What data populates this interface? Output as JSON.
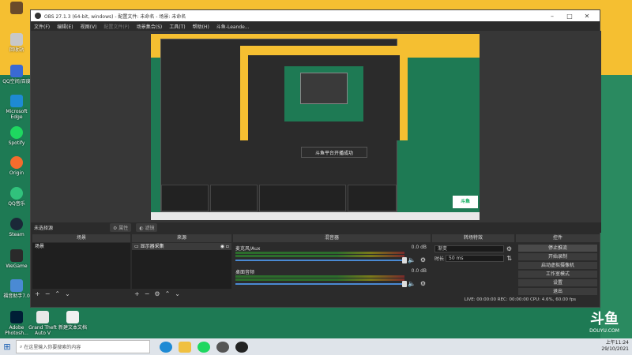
{
  "desktop": {
    "icons": [
      {
        "label": "",
        "color": "#6a4a2a"
      },
      {
        "label": "回收站",
        "color": "#c8c8c8"
      },
      {
        "label": "QQ空间/百度",
        "color": "#3a6ad4"
      },
      {
        "label": "Microsoft Edge",
        "color": "#1e8ad4"
      },
      {
        "label": "Spotify",
        "color": "#1ed760"
      },
      {
        "label": "Origin",
        "color": "#f56c2d"
      },
      {
        "label": "QQ音乐",
        "color": "#31c27c"
      },
      {
        "label": "Steam",
        "color": "#1b2838"
      },
      {
        "label": "WeGame",
        "color": "#2a2a2a"
      },
      {
        "label": "福音助手7.0",
        "color": "#4a8ad4"
      },
      {
        "label": "Adobe Photosh...",
        "color": "#001e36"
      },
      {
        "label": "Grand Theft Auto V",
        "color": "#e8e8e8"
      },
      {
        "label": "新建文本文档",
        "color": "#f0f0f0"
      }
    ]
  },
  "obs": {
    "title": "OBS 27.1.3 (64-bit, windows) - 配置文件: 未命名 - 场景: 未命名",
    "menu": [
      {
        "label": "文件(F)",
        "dim": false
      },
      {
        "label": "编辑(E)",
        "dim": false
      },
      {
        "label": "视图(V)",
        "dim": false
      },
      {
        "label": "配置文件(P)",
        "dim": true
      },
      {
        "label": "场景集合(S)",
        "dim": false
      },
      {
        "label": "工具(T)",
        "dim": false
      },
      {
        "label": "帮助(H)",
        "dim": false
      },
      {
        "label": "斗鱼-Leande...",
        "dim": false
      }
    ],
    "preview": {
      "toast": "斗鱼平台开播成功",
      "douyu_badge": "斗鱼"
    },
    "status": {
      "source_label": "未选择源",
      "props_btn": "属性",
      "filters_btn": "滤镜"
    },
    "docks": {
      "scenes": {
        "header": "场景",
        "items": [
          "场景"
        ]
      },
      "sources": {
        "header": "来源",
        "items": [
          "显示器采集"
        ]
      },
      "mixer": {
        "header": "混音器",
        "channels": [
          {
            "name": "麦克风/Aux",
            "db": "0.0 dB"
          },
          {
            "name": "桌面音频",
            "db": "0.0 dB"
          }
        ]
      },
      "transitions": {
        "header": "转场特效",
        "type": "渐变",
        "duration_label": "时长",
        "duration": "50 ms"
      },
      "controls": {
        "header": "控件",
        "buttons": [
          "停止推流",
          "开始录制",
          "启动虚拟摄像机",
          "工作室模式",
          "设置",
          "退出"
        ]
      }
    },
    "statsbar": "LIVE: 00:00:00   REC: 00:00:00   CPU: 4.6%, 60.00 fps"
  },
  "watermark": {
    "logo": "斗鱼",
    "sub": "DOUYU.COM"
  },
  "taskbar": {
    "search_placeholder": "在这里输入你要搜索的内容",
    "time": "上午11:24",
    "date": "29/10/2021"
  }
}
